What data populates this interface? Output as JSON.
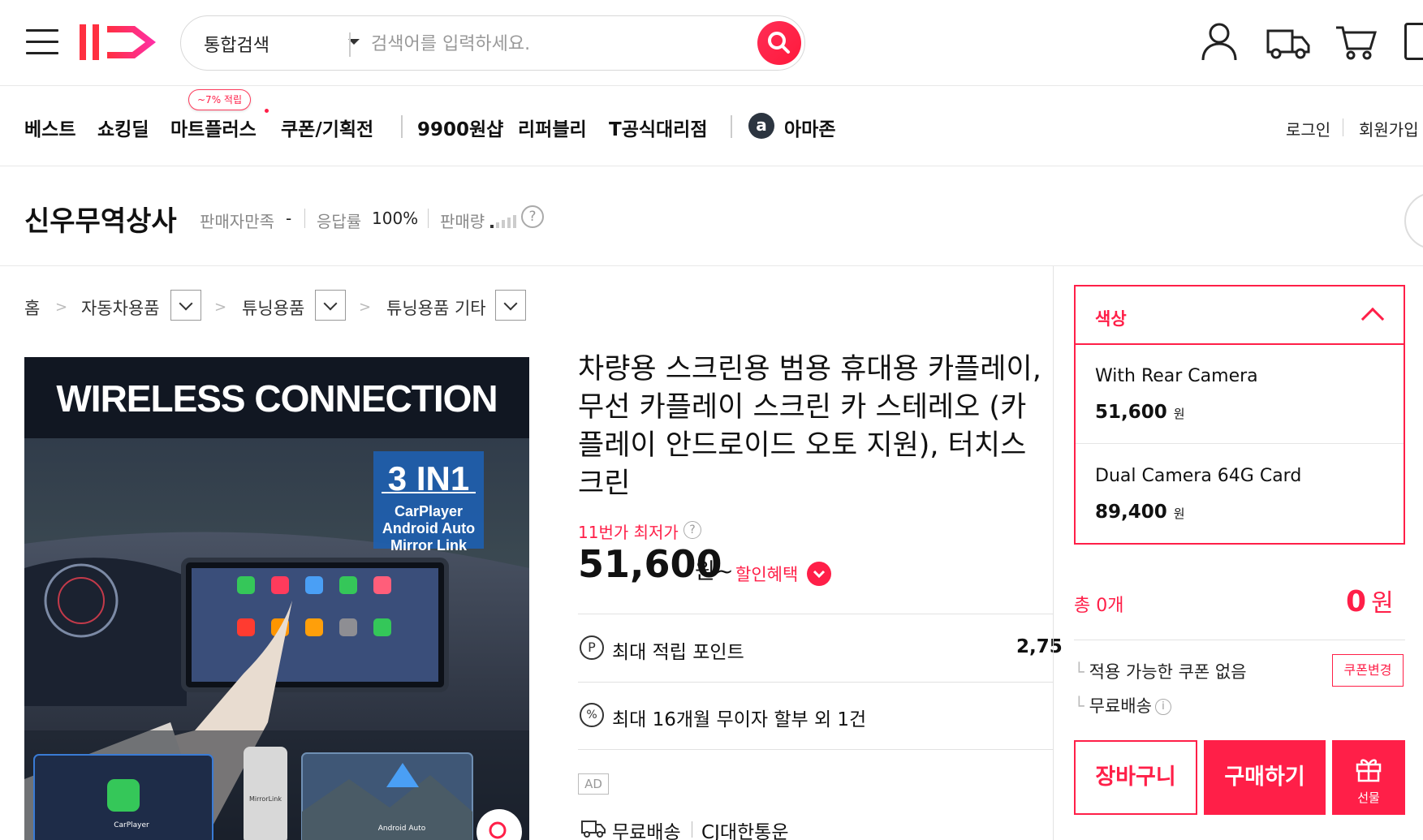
{
  "header": {
    "logo_text": "11",
    "search": {
      "category": "통합검색",
      "placeholder": "검색어를 입력하세요."
    },
    "icons": [
      "user-icon",
      "truck-icon",
      "cart-icon"
    ]
  },
  "nav": {
    "items": [
      "베스트",
      "쇼킹딜",
      "마트플러스",
      "쿠폰/기획전",
      "9900원샵",
      "리퍼블리",
      "T공식대리점",
      "아마존"
    ],
    "badge": "~7% 적립",
    "login": "로그인",
    "signup": "회원가입"
  },
  "seller": {
    "name": "신우무역상사",
    "satisfaction_label": "판매자만족",
    "satisfaction_value": "-",
    "response_label": "응답률",
    "response_value": "100%",
    "sales_label": "판매량",
    "help": "?"
  },
  "breadcrumb": {
    "home": "홈",
    "levels": [
      "자동차용품",
      "튜닝용품",
      "튜닝용품 기타"
    ]
  },
  "product": {
    "image": {
      "headline": "WIRELESS CONNECTION",
      "badge_title": "3 IN1",
      "badge_lines": [
        "CarPlayer",
        "Android Auto",
        "Mirror Link"
      ],
      "thumb_labels": [
        "CarPlayer",
        "MirrorLink",
        "Android Auto"
      ]
    },
    "title": "차량용 스크린용 범용 휴대용 카플레이, 무선 카플레이 스크린 카 스테레오 (카플레이 안드로이드 오토 지원), 터치스크린",
    "lowest_label": "11번가 최저가",
    "price": "51,600",
    "price_unit": "원~",
    "discount_label": "할인혜택",
    "points_label": "최대 적립 포인트",
    "points_value": "2,75",
    "installment": "최대 16개월 무이자 할부 외 1건",
    "ad": "AD",
    "shipping": "무료배송",
    "courier": "CJ대한통운"
  },
  "order_panel": {
    "option_title": "색상",
    "options": [
      {
        "name": "With Rear Camera",
        "price": "51,600",
        "unit": "원"
      },
      {
        "name": "Dual Camera 64G Card",
        "price": "89,400",
        "unit": "원"
      }
    ],
    "total_label": "총 0개",
    "total_value": "0",
    "total_unit": "원",
    "coupon_text": "적용 가능한 쿠폰 없음",
    "coupon_button": "쿠폰변경",
    "free_shipping": "무료배송",
    "cart_button": "장바구니",
    "buy_button": "구매하기",
    "gift_button": "선물"
  },
  "colors": {
    "accent": "#ff1f48",
    "text": "#111111"
  }
}
